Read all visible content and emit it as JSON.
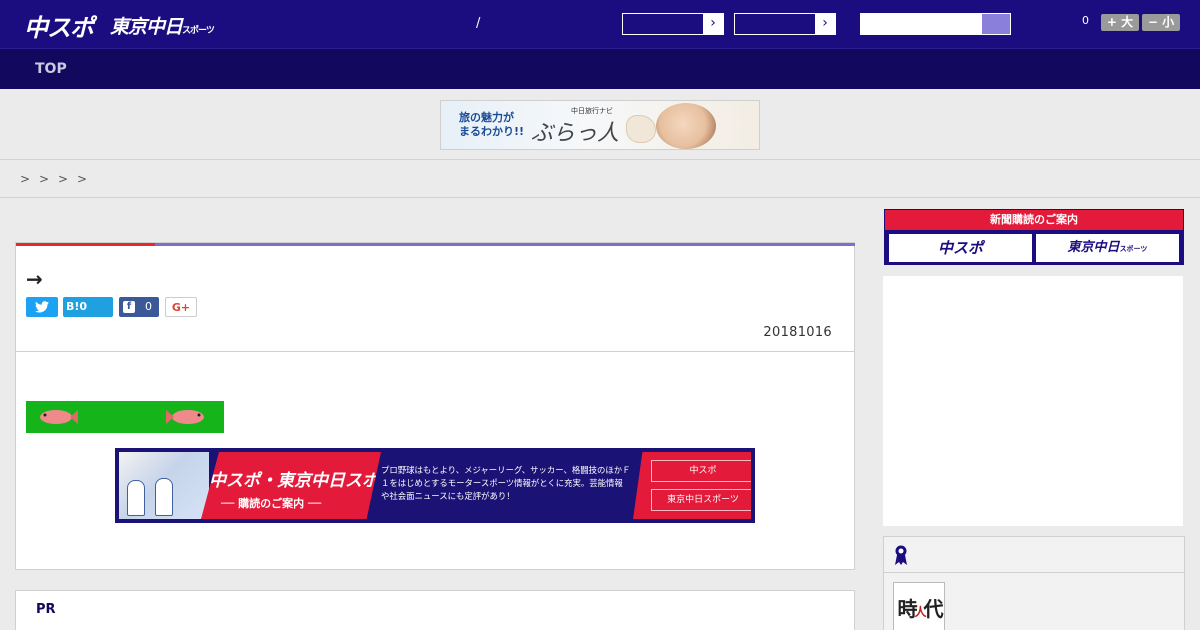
{
  "header": {
    "logo_chuspo": "中スポ",
    "logo_tokyo": "東京中日",
    "logo_tokyo_sub": "スポーツ",
    "slash": "/",
    "select1_arrow": "›",
    "select2_arrow": "›",
    "font_count": "0",
    "font_larger": "+ 大",
    "font_smaller": "− 小"
  },
  "nav": {
    "top": "TOP"
  },
  "banner_ad": {
    "line1": "旅の魅力が",
    "line2": "まるわかり!!",
    "brand_small": "中日旅行ナビ",
    "brand": "ぶらっ人"
  },
  "breadcrumb": [
    ">",
    ">",
    ">",
    ">"
  ],
  "article": {
    "title": "→",
    "share": {
      "twitter_icon": "twitter-icon",
      "hatena": "B!0",
      "facebook_letter": "f",
      "facebook_count": "0",
      "gplus": "G+"
    },
    "date": "20181016"
  },
  "chuspo_ad": {
    "heading": "中スポ・東京中日スポーツ",
    "sub": "── 購読のご案内 ──",
    "desc": "プロ野球はもとより、メジャーリーグ、サッカー、格闘技のほかＦ１をはじめとするモータースポーツ情報がとくに充実。芸能情報や社会面ニュースにも定評があり！",
    "btn1": "中スポ",
    "btn2": "東京中日スポーツ"
  },
  "pr": {
    "label": "PR"
  },
  "sidebar": {
    "subscription_header": "新聞購読のご案内",
    "subscription_btn1": "中スポ",
    "subscription_btn2": "東京中日",
    "subscription_btn2_sub": "スポーツ",
    "thumb_text1": "時",
    "thumb_text2": "人",
    "thumb_text3": "代"
  },
  "colors": {
    "header_bg": "#1b0d80",
    "nav_bg": "#12085e",
    "accent_red": "#e41a3a",
    "accent_purple": "#7f6ccc"
  }
}
